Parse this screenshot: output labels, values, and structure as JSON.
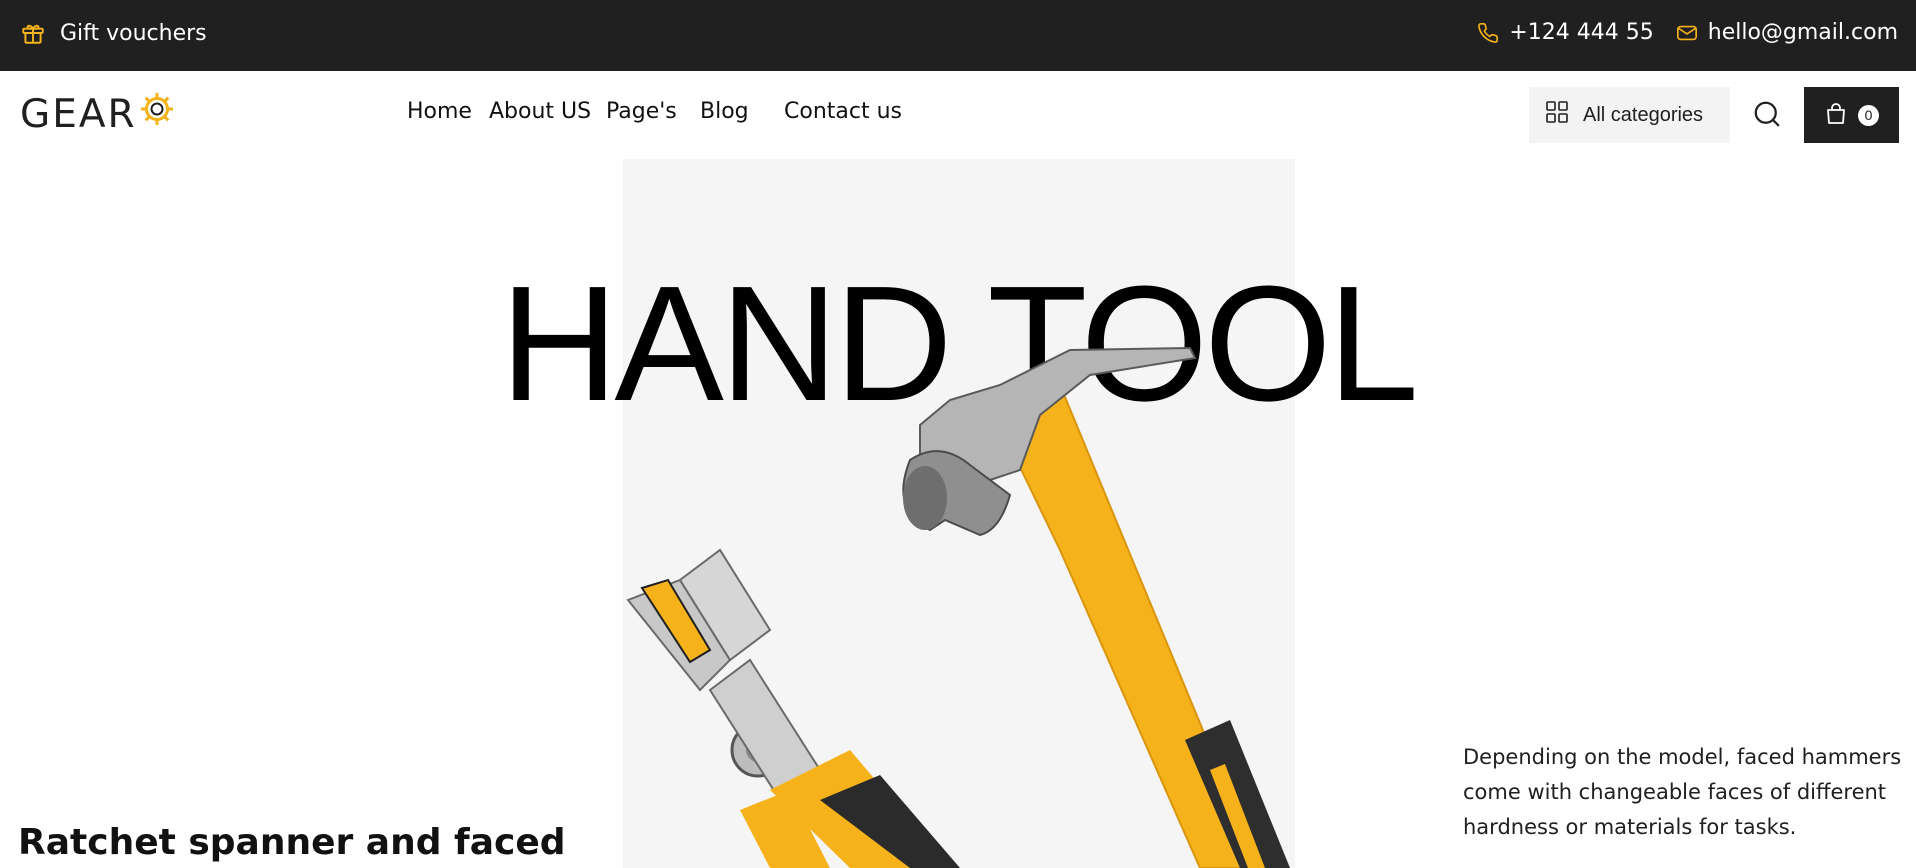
{
  "topbar": {
    "gift_label": "Gift vouchers",
    "phone": "+124 444 55",
    "email": "hello@gmail.com",
    "icons": {
      "gift": "gift-icon",
      "phone": "phone-icon",
      "email": "mail-icon"
    },
    "accent_color": "#f5b21a"
  },
  "header": {
    "logo_text": "GEAR",
    "nav": [
      "Home",
      "About US",
      "Page's",
      "Blog",
      "Contact us"
    ],
    "categories_label": "All categories",
    "cart_count": "0",
    "icons": {
      "categories": "grid-icon",
      "search": "search-icon",
      "cart": "shopping-bag-icon"
    }
  },
  "hero": {
    "title": "HAND TOOL",
    "description": "Depending on the model, faced hammers come with changeable faces of different hardness or materials for tasks.",
    "subtitle": "Ratchet spanner and faced"
  },
  "colors": {
    "dark": "#202020",
    "accent": "#f5b21a",
    "hero_panel": "#f5f5f5"
  }
}
